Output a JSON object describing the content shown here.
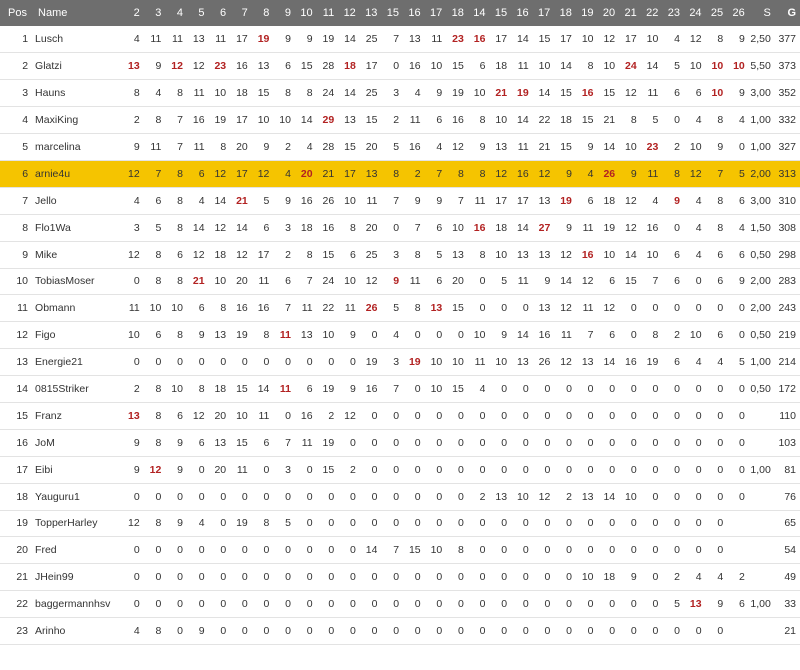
{
  "columns": [
    "Pos",
    "Name",
    "2",
    "3",
    "4",
    "5",
    "6",
    "7",
    "8",
    "9",
    "10",
    "11",
    "12",
    "13",
    "15",
    "16",
    "17",
    "18",
    "14",
    "15",
    "16",
    "17",
    "18",
    "19",
    "20",
    "21",
    "22",
    "23",
    "24",
    "25",
    "26",
    "S",
    "G"
  ],
  "highlight_color": "#f5c400",
  "red_color": "#b22222",
  "rows": [
    {
      "pos": "1",
      "name": "Lusch",
      "cells": [
        "4",
        "11",
        "11",
        "13",
        "11",
        "17",
        "19",
        "9",
        "9",
        "19",
        "14",
        "25",
        "7",
        "13",
        "11",
        "23",
        "16",
        "17",
        "14",
        "15",
        "17",
        "10",
        "12",
        "17",
        "10",
        "4",
        "12",
        "8",
        "9"
      ],
      "red": [
        6,
        15,
        16
      ],
      "s": "2,50",
      "g": "377"
    },
    {
      "pos": "2",
      "name": "Glatzi",
      "cells": [
        "13",
        "9",
        "12",
        "12",
        "23",
        "16",
        "13",
        "6",
        "15",
        "28",
        "18",
        "17",
        "0",
        "16",
        "10",
        "15",
        "6",
        "18",
        "11",
        "10",
        "14",
        "8",
        "10",
        "24",
        "14",
        "5",
        "10",
        "10",
        "10"
      ],
      "red": [
        0,
        2,
        4,
        10,
        23,
        27,
        28
      ],
      "s": "5,50",
      "g": "373"
    },
    {
      "pos": "3",
      "name": "Hauns",
      "cells": [
        "8",
        "4",
        "8",
        "11",
        "10",
        "18",
        "15",
        "8",
        "8",
        "24",
        "14",
        "25",
        "3",
        "4",
        "9",
        "19",
        "10",
        "21",
        "19",
        "14",
        "15",
        "16",
        "15",
        "12",
        "11",
        "6",
        "6",
        "10",
        "9"
      ],
      "red": [
        17,
        18,
        21,
        27
      ],
      "s": "3,00",
      "g": "352"
    },
    {
      "pos": "4",
      "name": "MaxiKing",
      "cells": [
        "2",
        "8",
        "7",
        "16",
        "19",
        "17",
        "10",
        "10",
        "14",
        "29",
        "13",
        "15",
        "2",
        "11",
        "6",
        "16",
        "8",
        "10",
        "14",
        "22",
        "18",
        "15",
        "21",
        "8",
        "5",
        "0",
        "4",
        "8",
        "4"
      ],
      "red": [
        9
      ],
      "s": "1,00",
      "g": "332"
    },
    {
      "pos": "5",
      "name": "marcelina",
      "cells": [
        "9",
        "11",
        "7",
        "11",
        "8",
        "20",
        "9",
        "2",
        "4",
        "28",
        "15",
        "20",
        "5",
        "16",
        "4",
        "12",
        "9",
        "13",
        "11",
        "21",
        "15",
        "9",
        "14",
        "10",
        "23",
        "2",
        "10",
        "9",
        "0"
      ],
      "red": [
        24
      ],
      "s": "1,00",
      "g": "327"
    },
    {
      "pos": "6",
      "name": "arnie4u",
      "cells": [
        "12",
        "7",
        "8",
        "6",
        "12",
        "17",
        "12",
        "4",
        "20",
        "21",
        "17",
        "13",
        "8",
        "2",
        "7",
        "8",
        "8",
        "12",
        "16",
        "12",
        "9",
        "4",
        "26",
        "9",
        "11",
        "8",
        "12",
        "7",
        "5"
      ],
      "red": [
        8,
        22
      ],
      "s": "2,00",
      "g": "313",
      "highlight": true
    },
    {
      "pos": "7",
      "name": "Jello",
      "cells": [
        "4",
        "6",
        "8",
        "4",
        "14",
        "21",
        "5",
        "9",
        "16",
        "26",
        "10",
        "11",
        "7",
        "9",
        "9",
        "7",
        "11",
        "17",
        "17",
        "13",
        "19",
        "6",
        "18",
        "12",
        "4",
        "9",
        "4",
        "8",
        "6"
      ],
      "red": [
        5,
        20,
        25
      ],
      "s": "3,00",
      "g": "310"
    },
    {
      "pos": "8",
      "name": "Flo1Wa",
      "cells": [
        "3",
        "5",
        "8",
        "14",
        "12",
        "14",
        "6",
        "3",
        "18",
        "16",
        "8",
        "20",
        "0",
        "7",
        "6",
        "10",
        "16",
        "18",
        "14",
        "27",
        "9",
        "11",
        "19",
        "12",
        "16",
        "0",
        "4",
        "8",
        "4"
      ],
      "red": [
        16,
        19
      ],
      "s": "1,50",
      "g": "308"
    },
    {
      "pos": "9",
      "name": "Mike",
      "cells": [
        "12",
        "8",
        "6",
        "12",
        "18",
        "12",
        "17",
        "2",
        "8",
        "15",
        "6",
        "25",
        "3",
        "8",
        "5",
        "13",
        "8",
        "10",
        "13",
        "13",
        "12",
        "16",
        "10",
        "14",
        "10",
        "6",
        "4",
        "6",
        "6"
      ],
      "red": [
        21
      ],
      "s": "0,50",
      "g": "298"
    },
    {
      "pos": "10",
      "name": "TobiasMoser",
      "cells": [
        "0",
        "8",
        "8",
        "21",
        "10",
        "20",
        "11",
        "6",
        "7",
        "24",
        "10",
        "12",
        "9",
        "11",
        "6",
        "20",
        "0",
        "5",
        "11",
        "9",
        "14",
        "12",
        "6",
        "15",
        "7",
        "6",
        "0",
        "6",
        "9"
      ],
      "red": [
        3,
        12
      ],
      "s": "2,00",
      "g": "283"
    },
    {
      "pos": "11",
      "name": "Obmann",
      "cells": [
        "11",
        "10",
        "10",
        "6",
        "8",
        "16",
        "16",
        "7",
        "11",
        "22",
        "11",
        "26",
        "5",
        "8",
        "13",
        "15",
        "0",
        "0",
        "0",
        "13",
        "12",
        "11",
        "12",
        "0",
        "0",
        "0",
        "0",
        "0",
        "0"
      ],
      "red": [
        11,
        14
      ],
      "s": "2,00",
      "g": "243"
    },
    {
      "pos": "12",
      "name": "Figo",
      "cells": [
        "10",
        "6",
        "8",
        "9",
        "13",
        "19",
        "8",
        "11",
        "13",
        "10",
        "9",
        "0",
        "4",
        "0",
        "0",
        "0",
        "10",
        "9",
        "14",
        "16",
        "11",
        "7",
        "6",
        "0",
        "8",
        "2",
        "10",
        "6",
        "0"
      ],
      "red": [
        7
      ],
      "s": "0,50",
      "g": "219"
    },
    {
      "pos": "13",
      "name": "Energie21",
      "cells": [
        "0",
        "0",
        "0",
        "0",
        "0",
        "0",
        "0",
        "0",
        "0",
        "0",
        "0",
        "19",
        "3",
        "19",
        "10",
        "10",
        "11",
        "10",
        "13",
        "26",
        "12",
        "13",
        "14",
        "16",
        "19",
        "6",
        "4",
        "4",
        "5"
      ],
      "red": [
        13
      ],
      "s": "1,00",
      "g": "214"
    },
    {
      "pos": "14",
      "name": "0815Striker",
      "cells": [
        "2",
        "8",
        "10",
        "8",
        "18",
        "15",
        "14",
        "11",
        "6",
        "19",
        "9",
        "16",
        "7",
        "0",
        "10",
        "15",
        "4",
        "0",
        "0",
        "0",
        "0",
        "0",
        "0",
        "0",
        "0",
        "0",
        "0",
        "0",
        "0"
      ],
      "red": [
        7
      ],
      "s": "0,50",
      "g": "172"
    },
    {
      "pos": "15",
      "name": "Franz",
      "cells": [
        "13",
        "8",
        "6",
        "12",
        "20",
        "10",
        "11",
        "0",
        "16",
        "2",
        "12",
        "0",
        "0",
        "0",
        "0",
        "0",
        "0",
        "0",
        "0",
        "0",
        "0",
        "0",
        "0",
        "0",
        "0",
        "0",
        "0",
        "0",
        "0"
      ],
      "red": [
        0
      ],
      "s": "",
      "g": "110"
    },
    {
      "pos": "16",
      "name": "JoM",
      "cells": [
        "9",
        "8",
        "9",
        "6",
        "13",
        "15",
        "6",
        "7",
        "11",
        "19",
        "0",
        "0",
        "0",
        "0",
        "0",
        "0",
        "0",
        "0",
        "0",
        "0",
        "0",
        "0",
        "0",
        "0",
        "0",
        "0",
        "0",
        "0",
        "0"
      ],
      "red": [],
      "s": "",
      "g": "103"
    },
    {
      "pos": "17",
      "name": "Eibi",
      "cells": [
        "9",
        "12",
        "9",
        "0",
        "20",
        "11",
        "0",
        "3",
        "0",
        "15",
        "2",
        "0",
        "0",
        "0",
        "0",
        "0",
        "0",
        "0",
        "0",
        "0",
        "0",
        "0",
        "0",
        "0",
        "0",
        "0",
        "0",
        "0",
        "0"
      ],
      "red": [
        1
      ],
      "s": "1,00",
      "g": "81"
    },
    {
      "pos": "18",
      "name": "Yauguru1",
      "cells": [
        "0",
        "0",
        "0",
        "0",
        "0",
        "0",
        "0",
        "0",
        "0",
        "0",
        "0",
        "0",
        "0",
        "0",
        "0",
        "0",
        "2",
        "13",
        "10",
        "12",
        "2",
        "13",
        "14",
        "10",
        "0",
        "0",
        "0",
        "0",
        "0"
      ],
      "red": [],
      "s": "",
      "g": "76"
    },
    {
      "pos": "19",
      "name": "TopperHarley",
      "cells": [
        "12",
        "8",
        "9",
        "4",
        "0",
        "19",
        "8",
        "5",
        "0",
        "0",
        "0",
        "0",
        "0",
        "0",
        "0",
        "0",
        "0",
        "0",
        "0",
        "0",
        "0",
        "0",
        "0",
        "0",
        "0",
        "0",
        "0",
        "0",
        ""
      ],
      "red": [],
      "s": "",
      "g": "65"
    },
    {
      "pos": "20",
      "name": "Fred",
      "cells": [
        "0",
        "0",
        "0",
        "0",
        "0",
        "0",
        "0",
        "0",
        "0",
        "0",
        "0",
        "14",
        "7",
        "15",
        "10",
        "8",
        "0",
        "0",
        "0",
        "0",
        "0",
        "0",
        "0",
        "0",
        "0",
        "0",
        "0",
        "0",
        ""
      ],
      "red": [],
      "s": "",
      "g": "54"
    },
    {
      "pos": "21",
      "name": "JHein99",
      "cells": [
        "0",
        "0",
        "0",
        "0",
        "0",
        "0",
        "0",
        "0",
        "0",
        "0",
        "0",
        "0",
        "0",
        "0",
        "0",
        "0",
        "0",
        "0",
        "0",
        "0",
        "0",
        "10",
        "18",
        "9",
        "0",
        "2",
        "4",
        "4",
        "2"
      ],
      "red": [],
      "s": "",
      "g": "49"
    },
    {
      "pos": "22",
      "name": "baggermannhsv",
      "cells": [
        "0",
        "0",
        "0",
        "0",
        "0",
        "0",
        "0",
        "0",
        "0",
        "0",
        "0",
        "0",
        "0",
        "0",
        "0",
        "0",
        "0",
        "0",
        "0",
        "0",
        "0",
        "0",
        "0",
        "0",
        "0",
        "5",
        "13",
        "9",
        "6"
      ],
      "red": [
        26
      ],
      "s": "1,00",
      "g": "33"
    },
    {
      "pos": "23",
      "name": "Arinho",
      "cells": [
        "4",
        "8",
        "0",
        "9",
        "0",
        "0",
        "0",
        "0",
        "0",
        "0",
        "0",
        "0",
        "0",
        "0",
        "0",
        "0",
        "0",
        "0",
        "0",
        "0",
        "0",
        "0",
        "0",
        "0",
        "0",
        "0",
        "0",
        "0",
        ""
      ],
      "red": [],
      "s": "",
      "g": "21"
    }
  ]
}
